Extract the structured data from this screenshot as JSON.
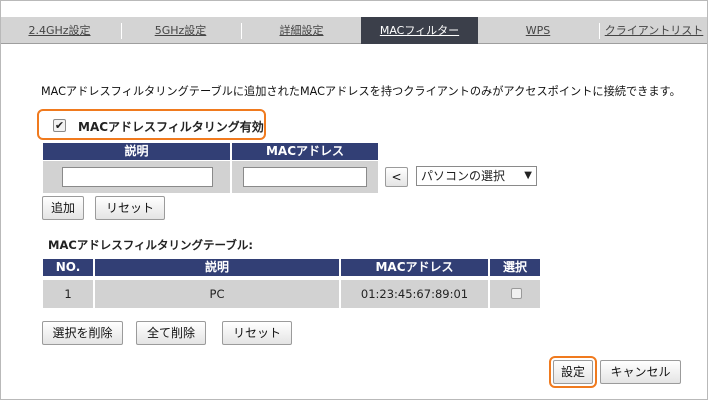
{
  "tabs": [
    {
      "label": "2.4GHz設定",
      "active": false
    },
    {
      "label": "5GHz設定",
      "active": false
    },
    {
      "label": "詳細設定",
      "active": false
    },
    {
      "label": "MACフィルター",
      "active": true
    },
    {
      "label": "WPS",
      "active": false
    },
    {
      "label": "クライアントリスト",
      "active": false
    }
  ],
  "description": "MACアドレスフィルタリングテーブルに追加されたMACアドレスを持つクライアントのみがアクセスポイントに接続できます。",
  "enable_filter": {
    "label": "MACアドレスフィルタリング有効",
    "checked": true
  },
  "add_form": {
    "headers": [
      "説明",
      "MACアドレス"
    ],
    "description_value": "",
    "mac_value": "",
    "arrow_label": "<",
    "pc_select": "パソコンの選択",
    "add_label": "追加",
    "reset_label": "リセット"
  },
  "table": {
    "title": "MACアドレスフィルタリングテーブル:",
    "headers": [
      "NO.",
      "説明",
      "MACアドレス",
      "選択"
    ],
    "rows": [
      {
        "no": "1",
        "description": "PC",
        "mac": "01:23:45:67:89:01",
        "selected": false
      }
    ],
    "delete_selected_label": "選択を削除",
    "delete_all_label": "全て削除",
    "reset_label": "リセット"
  },
  "footer": {
    "apply_label": "設定",
    "cancel_label": "キャンセル"
  },
  "colors": {
    "highlight": "#f07a1e",
    "header_bg": "#323f75",
    "active_tab": "#3b3f4a"
  }
}
